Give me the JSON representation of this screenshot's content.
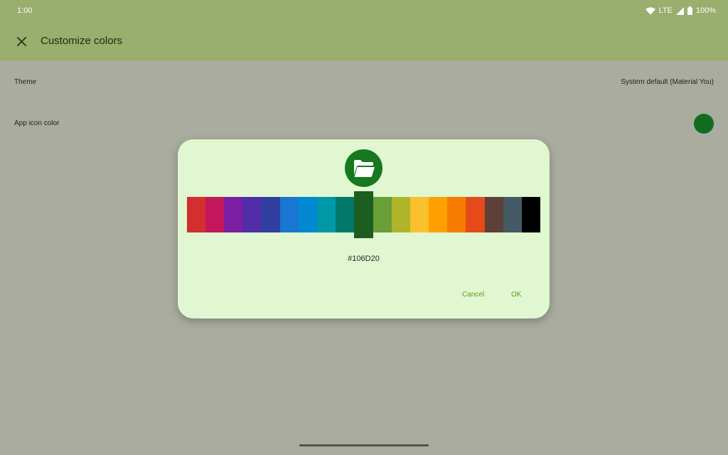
{
  "status_bar": {
    "time": "1:00",
    "network": "LTE",
    "battery": "100%",
    "icons": [
      "wifi-icon",
      "signal-icon",
      "battery-icon"
    ]
  },
  "app_bar": {
    "title": "Customize colors",
    "close_icon": "close-icon"
  },
  "settings": [
    {
      "label": "Theme",
      "value": "System default (Material You)"
    },
    {
      "label": "App icon color",
      "value_color": "#106D20"
    }
  ],
  "dialog": {
    "preview_icon": "folder-icon",
    "preview_color": "#16781F",
    "hex_value": "#106D20",
    "cancel_label": "Cancel",
    "ok_label": "OK",
    "selected_index": 9,
    "swatches": [
      "#D32F2F",
      "#C2185B",
      "#7B1FA2",
      "#512DA8",
      "#303F9F",
      "#1976D2",
      "#0288D1",
      "#0097A7",
      "#00796B",
      "#1B5E20",
      "#689F38",
      "#AFB42B",
      "#FBC02D",
      "#FFA000",
      "#F57C00",
      "#E64A19",
      "#5D4037",
      "#455A64",
      "#000000"
    ]
  },
  "colors": {
    "status_bar_bg": "#9AAE6D",
    "scrim_bg": "#A9AC9E",
    "dialog_bg": "#E0F7D2",
    "accent": "#5E9A13"
  }
}
